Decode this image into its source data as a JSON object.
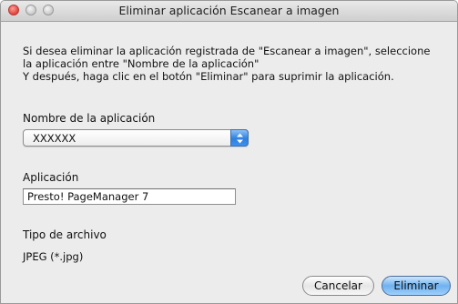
{
  "window": {
    "title": "Eliminar aplicación Escanear a imagen"
  },
  "icons": {
    "close": "close-icon",
    "minimize": "minimize-icon",
    "zoom": "zoom-icon",
    "popup": "updown-arrows-icon"
  },
  "instructions": {
    "line1": "Si desea eliminar la aplicación registrada de \"Escanear a imagen\", seleccione",
    "line2": "la aplicación entre \"Nombre de la aplicación\"",
    "line3": "Y después, haga clic en el botón \"Eliminar\" para suprimir la aplicación."
  },
  "app_name": {
    "label": "Nombre de la aplicación",
    "selected": "XXXXXX"
  },
  "application": {
    "label": "Aplicación",
    "value": "Presto! PageManager 7"
  },
  "file_type": {
    "label": "Tipo de archivo",
    "value": "JPEG (*.jpg)"
  },
  "buttons": {
    "cancel": "Cancelar",
    "delete": "Eliminar"
  },
  "colors": {
    "default_button": "#6fb1f0",
    "popup_arrows": "#2d7fe0",
    "close_button": "#e0443e"
  }
}
